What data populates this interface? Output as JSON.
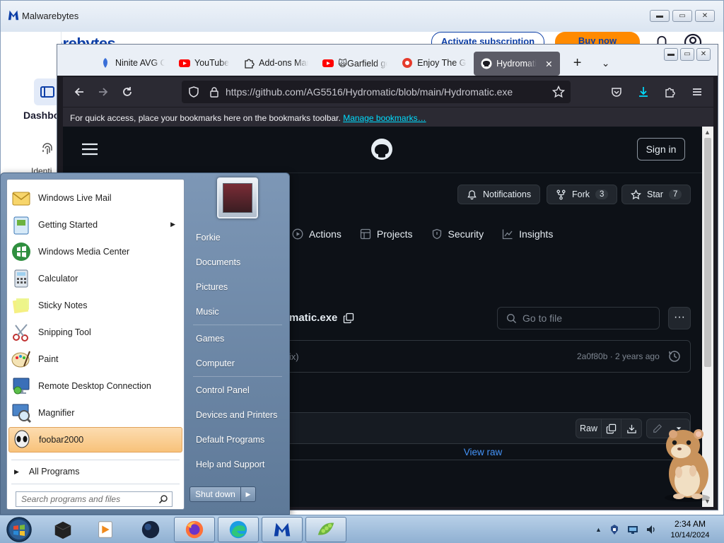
{
  "malwarebytes": {
    "window_title": "Malwarebytes",
    "brand": "Malwarebytes",
    "activate_label": "Activate subscription",
    "buynow_label": "Buy now",
    "sidebar": {
      "dashboard_label": "Dashbo",
      "identity_label": "Identi"
    }
  },
  "firefox": {
    "tabs": [
      {
        "label": "Ninite AVG Cl",
        "icon": "ninite-icon"
      },
      {
        "label": "YouTube",
        "icon": "youtube-icon"
      },
      {
        "label": "Add-ons Man",
        "icon": "puzzle-icon"
      },
      {
        "label": "🙀Garfield go",
        "icon": "youtube-icon"
      },
      {
        "label": "Enjoy The Ga",
        "icon": "game-icon"
      },
      {
        "label": "Hydromati",
        "icon": "github-icon",
        "active": true
      }
    ],
    "url": "https://github.com/AG5516/Hydromatic/blob/main/Hydromatic.exe",
    "bookmarks_bar_text": "For quick access, place your bookmarks here on the bookmarks toolbar.",
    "bookmarks_link": "Manage bookmarks…"
  },
  "github": {
    "signin_label": "Sign in",
    "notifications_label": "Notifications",
    "fork_label": "Fork",
    "fork_count": "3",
    "star_label": "Star",
    "star_count": "7",
    "tabs": [
      "Actions",
      "Projects",
      "Security",
      "Insights"
    ],
    "filename": "matic.exe",
    "goto_placeholder": "Go to file",
    "commit_message": "gfix)",
    "commit_meta": "2a0f80b · 2 years ago",
    "raw_label": "Raw",
    "view_raw_label": "View raw"
  },
  "start_menu": {
    "programs": [
      {
        "label": "Windows Live Mail",
        "icon": "mail-icon"
      },
      {
        "label": "Getting Started",
        "icon": "getting-started-icon",
        "submenu": true
      },
      {
        "label": "Windows Media Center",
        "icon": "media-center-icon"
      },
      {
        "label": "Calculator",
        "icon": "calculator-icon"
      },
      {
        "label": "Sticky Notes",
        "icon": "sticky-notes-icon"
      },
      {
        "label": "Snipping Tool",
        "icon": "scissors-icon"
      },
      {
        "label": "Paint",
        "icon": "paint-icon"
      },
      {
        "label": "Remote Desktop Connection",
        "icon": "remote-desktop-icon"
      },
      {
        "label": "Magnifier",
        "icon": "magnifier-icon"
      },
      {
        "label": "foobar2000",
        "icon": "foobar-icon",
        "highlighted": true
      }
    ],
    "all_programs_label": "All Programs",
    "search_placeholder": "Search programs and files",
    "right_items": [
      "Forkie",
      "Documents",
      "Pictures",
      "Music",
      "Games",
      "Computer",
      "Control Panel",
      "Devices and Printers",
      "Default Programs",
      "Help and Support"
    ],
    "shutdown_label": "Shut down"
  },
  "taskbar": {
    "apps": [
      "media-player-icon",
      "app-icon",
      "firefox-icon",
      "edge-icon",
      "malwarebytes-icon",
      "peas-icon"
    ],
    "clock_time": "2:34 AM",
    "clock_date": "10/14/2024"
  },
  "colors": {
    "github_bg": "#0d1117",
    "github_border": "#30363d",
    "firefox_toolbar": "#2b2a33",
    "mb_blue": "#0d3fa7",
    "mb_orange": "#ff8a00",
    "start_highlight": "#f8c27a"
  }
}
